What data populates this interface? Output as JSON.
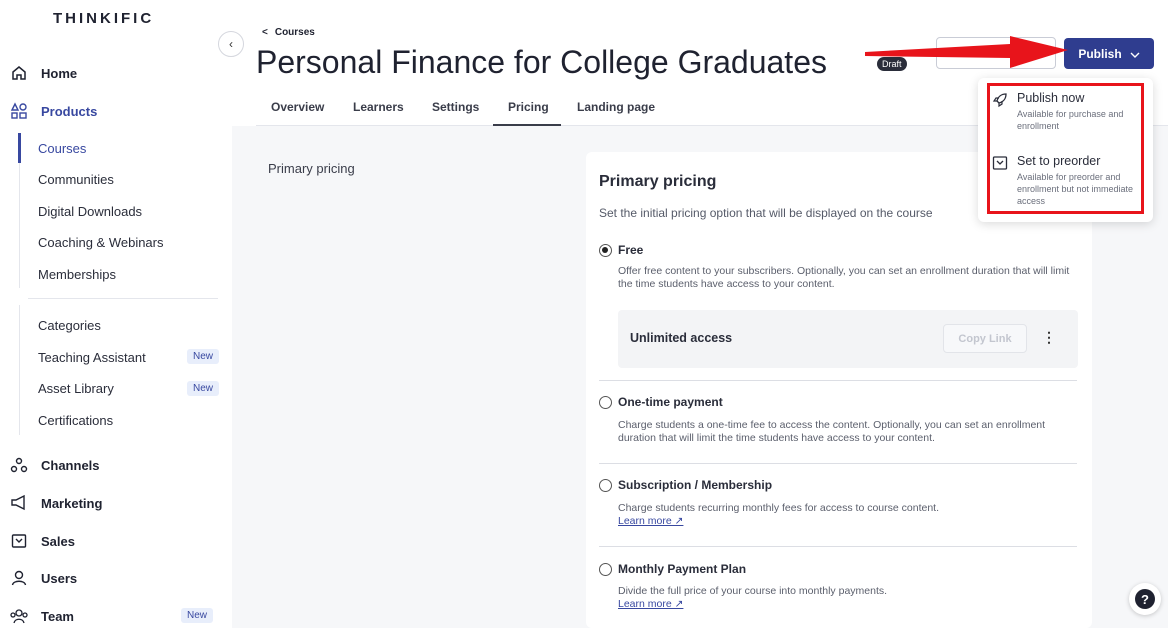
{
  "brand": {
    "logo_text": "THINKIFIC"
  },
  "sidebar": {
    "home": "Home",
    "products": "Products",
    "sub_items": [
      "Courses",
      "Communities",
      "Digital Downloads",
      "Coaching & Webinars",
      "Memberships",
      "Categories",
      "Teaching Assistant",
      "Asset Library",
      "Certifications"
    ],
    "new_badge": "New",
    "channels": "Channels",
    "marketing": "Marketing",
    "sales": "Sales",
    "users": "Users",
    "team": "Team"
  },
  "header": {
    "breadcrumb": "Courses",
    "title": "Personal Finance for College Graduates",
    "status_badge": "Draft",
    "publish_label": "Publish"
  },
  "tabs": [
    "Overview",
    "Learners",
    "Settings",
    "Pricing",
    "Landing page"
  ],
  "active_tab": "Pricing",
  "publish_menu": {
    "publish_now_title": "Publish now",
    "publish_now_desc": "Available for purchase and enrollment",
    "preorder_title": "Set to preorder",
    "preorder_desc": "Available for preorder and enrollment but not immediate access"
  },
  "pricing": {
    "section_label": "Primary pricing",
    "card_title": "Primary pricing",
    "card_subtitle": "Set the initial pricing option that will be displayed on the course",
    "options": [
      {
        "title": "Free",
        "desc": "Offer free content to your subscribers. Optionally, you can set an enrollment duration that will limit the time students have access to your content.",
        "selected": true
      },
      {
        "title": "One-time payment",
        "desc": "Charge students a one-time fee to access the content. Optionally, you can set an enrollment duration that will limit the time students have access to your content.",
        "selected": false
      },
      {
        "title": "Subscription / Membership",
        "desc": "Charge students recurring monthly fees for access to course content.",
        "selected": false
      },
      {
        "title": "Monthly Payment Plan",
        "desc": "Divide the full price of your course into monthly payments.",
        "selected": false
      }
    ],
    "unlimited_label": "Unlimited access",
    "copy_link": "Copy Link",
    "learn_more": "Learn more ↗"
  },
  "colors": {
    "accent": "#2f3d8f",
    "annotation_red": "#e8141b"
  }
}
